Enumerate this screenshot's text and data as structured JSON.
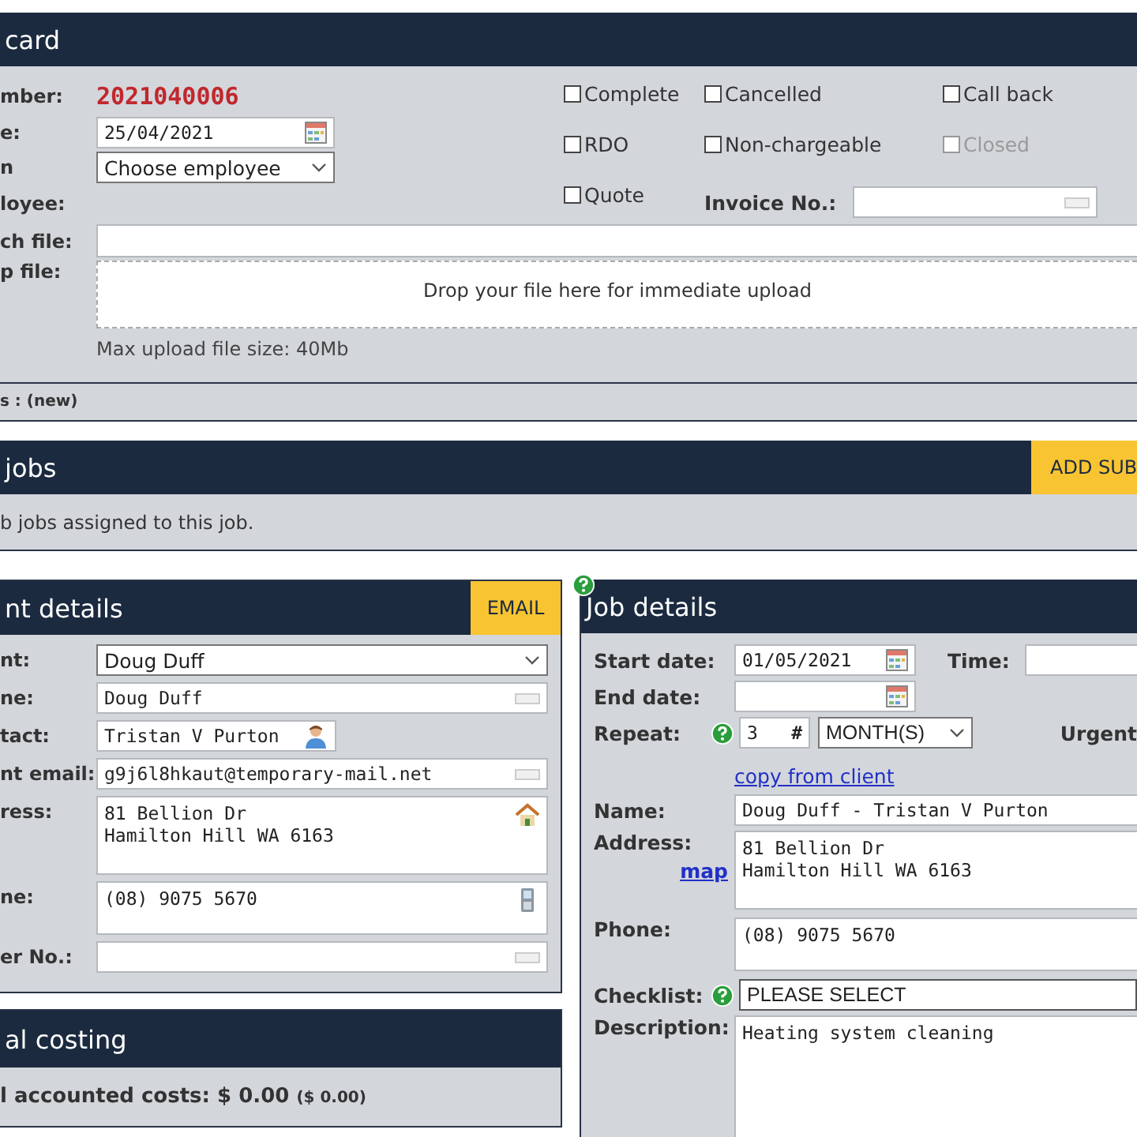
{
  "job_card": {
    "title": "card",
    "number_label": "mber:",
    "number": "2021040006",
    "date_label": "e:",
    "date": "25/04/2021",
    "employee_label": "n",
    "employee_select": "Choose employee",
    "employee2_label": "loyee:",
    "checkboxes": [
      {
        "label": "Complete",
        "checked": false,
        "disabled": false
      },
      {
        "label": "Cancelled",
        "checked": false,
        "disabled": false
      },
      {
        "label": "Call back",
        "checked": false,
        "disabled": false
      },
      {
        "label": "RDO",
        "checked": false,
        "disabled": false
      },
      {
        "label": "Non-chargeable",
        "checked": false,
        "disabled": false
      },
      {
        "label": "Closed",
        "checked": false,
        "disabled": true
      },
      {
        "label": "Quote",
        "checked": false,
        "disabled": false
      }
    ],
    "invoice_label": "Invoice No.:",
    "attach_label": "ch file:",
    "drop_label": "p file:",
    "drop_hint": "Drop your file here for immediate upload",
    "max_size": "Max upload file size: 40Mb",
    "status": "s : (new)"
  },
  "sub_jobs": {
    "title": "jobs",
    "add_button": "ADD SUB",
    "message": "b jobs assigned to this job."
  },
  "client_details": {
    "title": "nt details",
    "email_button": "EMAIL",
    "fields": [
      {
        "label": "nt:",
        "kind": "select",
        "value": "Doug Duff"
      },
      {
        "label": "ne:",
        "kind": "text",
        "value": "Doug Duff"
      },
      {
        "label": "tact:",
        "kind": "contact",
        "value": "Tristan V Purton"
      },
      {
        "label": "nt email:",
        "kind": "text",
        "value": "g9j6l8hkaut@temporary-mail.net"
      },
      {
        "label": "ress:",
        "kind": "address",
        "value": "81 Bellion Dr\nHamilton Hill WA 6163"
      },
      {
        "label": "ne:",
        "kind": "phone",
        "value": "(08) 9075 5670"
      },
      {
        "label": "er No.:",
        "kind": "text"
      }
    ]
  },
  "costing": {
    "title": "al costing",
    "label": "l accounted costs:",
    "total": "$ 0.00",
    "subtotal": "($ 0.00)"
  },
  "job_details": {
    "title": "Job details",
    "start_label": "Start date:",
    "start_date": "01/05/2021",
    "time_label": "Time:",
    "end_label": "End date:",
    "repeat_label": "Repeat:",
    "repeat_count": "3",
    "repeat_hash": "#",
    "repeat_unit": "MONTH(S)",
    "urgent_label": "Urgent",
    "copy_link": "copy from client",
    "name_label": "Name:",
    "name": "Doug Duff - Tristan V Purton",
    "address_label": "Address:",
    "map_link": "map",
    "address": "81 Bellion Dr\nHamilton Hill WA 6163",
    "phone_label": "Phone:",
    "phone": "(08) 9075 5670",
    "checklist_label": "Checklist:",
    "checklist": "PLEASE SELECT",
    "description_label": "Description:",
    "description": "Heating system cleaning"
  }
}
